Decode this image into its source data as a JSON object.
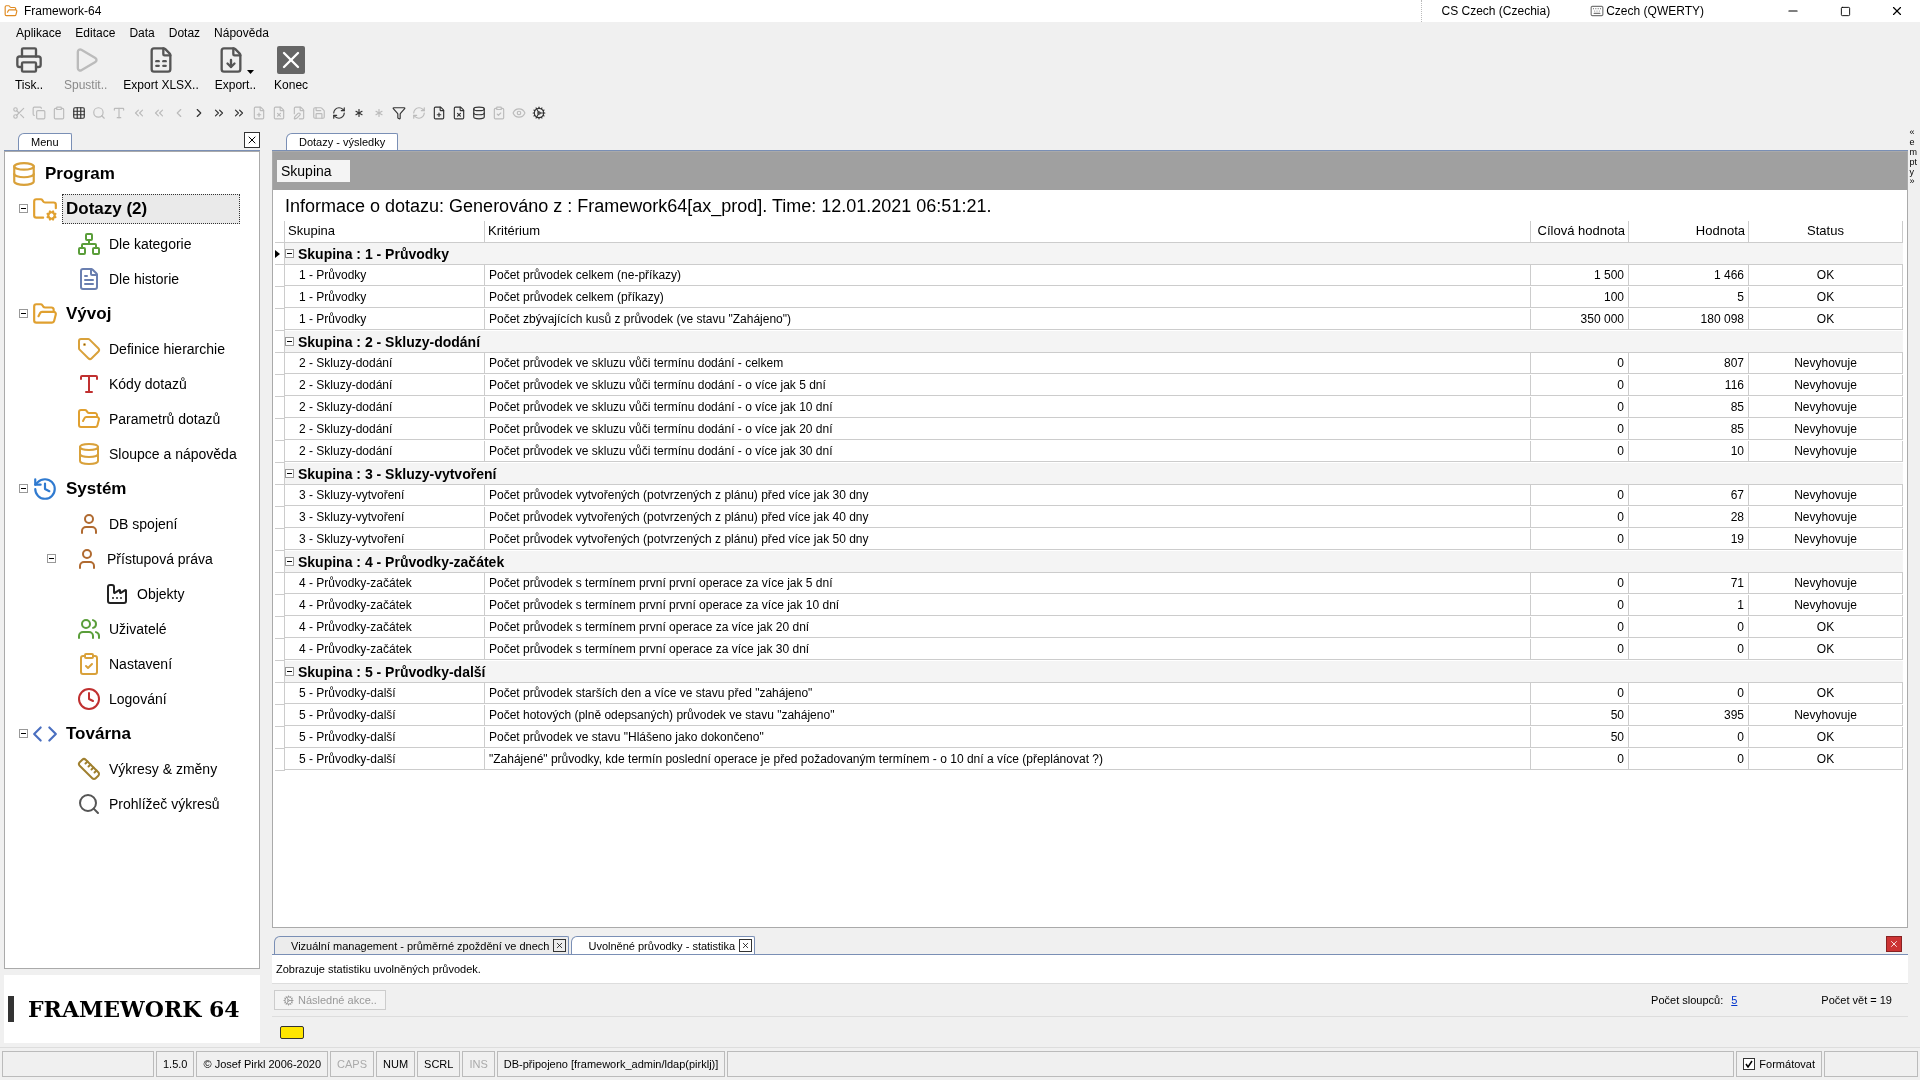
{
  "window": {
    "title": "Framework-64",
    "language": "CS Czech (Czechia)",
    "keyboard": "Czech (QWERTY)"
  },
  "menu": [
    "Aplikace",
    "Editace",
    "Data",
    "Dotaz",
    "Nápověda"
  ],
  "toolbar": [
    {
      "label": "Tisk..",
      "kind": "print",
      "disabled": false,
      "dropdown": false
    },
    {
      "label": "Spustit..",
      "kind": "run",
      "disabled": true,
      "dropdown": false
    },
    {
      "label": "Export XLSX..",
      "kind": "xlsx",
      "disabled": false,
      "dropdown": false
    },
    {
      "label": "Export..",
      "kind": "export",
      "disabled": false,
      "dropdown": true
    },
    {
      "label": "Konec",
      "kind": "close",
      "disabled": false,
      "dropdown": false
    }
  ],
  "sidebar": {
    "tab": "Menu",
    "tree": [
      {
        "label": "Program",
        "selected": false,
        "children": [
          {
            "label": "Dotazy (2)",
            "selected": true,
            "expanded": true,
            "children": [
              {
                "label": "Dle kategorie",
                "selected": false
              },
              {
                "label": "Dle historie",
                "selected": false
              }
            ]
          },
          {
            "label": "Vývoj",
            "selected": false,
            "expanded": true,
            "children": [
              {
                "label": "Definice hierarchie",
                "selected": false
              },
              {
                "label": "Kódy dotazů",
                "selected": false
              },
              {
                "label": "Parametrů dotazů",
                "selected": false
              },
              {
                "label": "Sloupce a nápověda",
                "selected": false
              }
            ]
          },
          {
            "label": "Systém",
            "selected": false,
            "expanded": true,
            "children": [
              {
                "label": "DB spojení",
                "selected": false
              },
              {
                "label": "Přístupová práva",
                "selected": false,
                "expanded": true,
                "children": [
                  {
                    "label": "Objekty",
                    "selected": false
                  }
                ]
              },
              {
                "label": "Uživatelé",
                "selected": false
              },
              {
                "label": "Nastavení",
                "selected": false
              },
              {
                "label": "Logování",
                "selected": false
              }
            ]
          },
          {
            "label": "Továrna",
            "selected": false,
            "expanded": true,
            "children": [
              {
                "label": "Výkresy & změny",
                "selected": false
              },
              {
                "label": "Prohlížeč výkresů",
                "selected": false
              }
            ]
          }
        ]
      }
    ]
  },
  "main_tab": {
    "label": "Dotazy - výsledky",
    "selected": true
  },
  "group_by": "Skupina",
  "info": "Informace o dotazu:  Generováno z : Framework64[ax_prod]. Time: 12.01.2021 06:51:21.",
  "columns": [
    "Skupina",
    "Kritérium",
    "Cílová hodnota",
    "Hodnota",
    "Status"
  ],
  "groups": [
    {
      "title": "Skupina : 1 - Průvodky",
      "expanded": true,
      "selected": true,
      "rows": [
        [
          "1 - Průvodky",
          "Počet průvodek celkem (ne-příkazy)",
          "1 500",
          "1 466",
          "OK"
        ],
        [
          "1 - Průvodky",
          "Počet průvodek celkem (příkazy)",
          "100",
          "5",
          "OK"
        ],
        [
          "1 - Průvodky",
          "Počet zbývajících kusů z průvodek (ve stavu \"Zahájeno\")",
          "350 000",
          "180 098",
          "OK"
        ]
      ]
    },
    {
      "title": "Skupina : 2 - Skluzy-dodání",
      "expanded": true,
      "selected": false,
      "rows": [
        [
          "2 - Skluzy-dodání",
          "Počet průvodek ve skluzu vůči termínu dodání - celkem",
          "0",
          "807",
          "Nevyhovuje"
        ],
        [
          "2 - Skluzy-dodání",
          "Počet průvodek ve skluzu vůči termínu dodání - o více jak 5 dní",
          "0",
          "116",
          "Nevyhovuje"
        ],
        [
          "2 - Skluzy-dodání",
          "Počet průvodek ve skluzu vůči termínu dodání - o více jak 10 dní",
          "0",
          "85",
          "Nevyhovuje"
        ],
        [
          "2 - Skluzy-dodání",
          "Počet průvodek ve skluzu vůči termínu dodání - o více jak 20 dní",
          "0",
          "85",
          "Nevyhovuje"
        ],
        [
          "2 - Skluzy-dodání",
          "Počet průvodek ve skluzu vůči termínu dodání - o více jak 30 dní",
          "0",
          "10",
          "Nevyhovuje"
        ]
      ]
    },
    {
      "title": "Skupina : 3 - Skluzy-vytvoření",
      "expanded": true,
      "selected": false,
      "rows": [
        [
          "3 - Skluzy-vytvoření",
          "Počet průvodek vytvořených (potvrzených z plánu) před více jak 30 dny",
          "0",
          "67",
          "Nevyhovuje"
        ],
        [
          "3 - Skluzy-vytvoření",
          "Počet průvodek vytvořených (potvrzených z plánu) před více jak 40 dny",
          "0",
          "28",
          "Nevyhovuje"
        ],
        [
          "3 - Skluzy-vytvoření",
          "Počet průvodek vytvořených (potvrzených z plánu) před více jak 50 dny",
          "0",
          "19",
          "Nevyhovuje"
        ]
      ]
    },
    {
      "title": "Skupina : 4 - Průvodky-začátek",
      "expanded": true,
      "selected": false,
      "rows": [
        [
          "4 - Průvodky-začátek",
          "Počet průvodek s termínem první první operace za více jak 5 dní",
          "0",
          "71",
          "Nevyhovuje"
        ],
        [
          "4 - Průvodky-začátek",
          "Počet průvodek s termínem první první operace za více jak 10 dní",
          "0",
          "1",
          "Nevyhovuje"
        ],
        [
          "4 - Průvodky-začátek",
          "Počet průvodek s termínem první operace za více jak 20 dní",
          "0",
          "0",
          "OK"
        ],
        [
          "4 - Průvodky-začátek",
          "Počet průvodek s termínem první operace za více jak 30 dní",
          "0",
          "0",
          "OK"
        ]
      ]
    },
    {
      "title": "Skupina : 5 - Průvodky-další",
      "expanded": true,
      "selected": false,
      "rows": [
        [
          "5 - Průvodky-další",
          "Počet průvodek starších den a více ve stavu před \"zahájeno\"",
          "0",
          "0",
          "OK"
        ],
        [
          "5 - Průvodky-další",
          "Počet hotových (plně odepsaných) průvodek ve stavu \"zahájeno\"",
          "50",
          "395",
          "Nevyhovuje"
        ],
        [
          "5 - Průvodky-další",
          "Počet průvodek ve stavu \"Hlášeno jako dokončeno\"",
          "50",
          "0",
          "OK"
        ],
        [
          "5 - Průvodky-další",
          "\"Zahájené\" průvodky, kde termín poslední operace je před požadovaným termínem - o 10 dní a více (přeplánovat ?)",
          "0",
          "0",
          "OK"
        ]
      ]
    }
  ],
  "side_label": "« empty »",
  "bottom_tabs": [
    {
      "label": "Vizuální management - průměrné zpoždění ve dnech",
      "selected": false
    },
    {
      "label": "Uvolněné průvodky - statistika",
      "selected": true
    }
  ],
  "description": "Zobrazuje statistiku uvolněných průvodek.",
  "action": {
    "label": "Následné akce..",
    "disabled": true
  },
  "column_count": {
    "label": "Počet sloupců:",
    "value": "5"
  },
  "record_count": "Počet vět = 19",
  "logo": "FRAMEWORK 64",
  "status_bar": [
    {
      "text": "1.5.0",
      "disabled": false
    },
    {
      "text": "© Josef Pirkl 2006-2020",
      "disabled": false
    },
    {
      "text": "CAPS",
      "disabled": true
    },
    {
      "text": "NUM",
      "disabled": false
    },
    {
      "text": "SCRL",
      "disabled": false
    },
    {
      "text": "INS",
      "disabled": true
    },
    {
      "text": "DB-připojeno [framework_admin/ldap(pirklj)]",
      "disabled": false
    }
  ],
  "format_option": {
    "label": "Formátovat",
    "checked": true
  }
}
